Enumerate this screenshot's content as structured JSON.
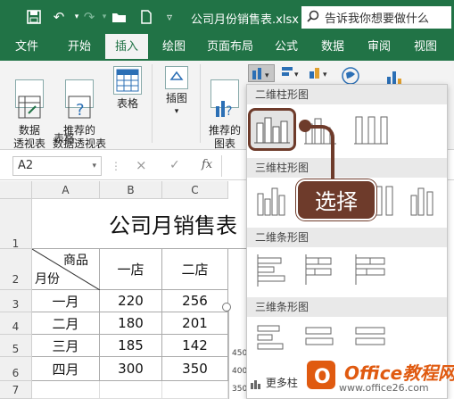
{
  "title_bar": {
    "filename": "公司月份销售表.xlsx  -...",
    "tell_me": "告诉我你想要做什么"
  },
  "tabs": [
    {
      "label": "文件"
    },
    {
      "label": "开始"
    },
    {
      "label": "插入"
    },
    {
      "label": "绘图"
    },
    {
      "label": "页面布局"
    },
    {
      "label": "公式"
    },
    {
      "label": "数据"
    },
    {
      "label": "审阅"
    },
    {
      "label": "视图"
    }
  ],
  "ribbon": {
    "pivot_table": "数据\n透视表",
    "recommended_pivot": "推荐的\n数据透视表",
    "table": "表格",
    "illustrations": "插图",
    "recommended_charts": "推荐的\n图表",
    "group_tables": "表格"
  },
  "formula_bar": {
    "name_box": "A2",
    "cancel": "×",
    "enter": "✓",
    "fx": "fx"
  },
  "sheet": {
    "columns": [
      "A",
      "B",
      "C"
    ],
    "rows": [
      "1",
      "2",
      "3",
      "4",
      "5",
      "6",
      "7"
    ],
    "title": "公司月销售表",
    "header_goods": "商品",
    "header_month": "月份",
    "col_b": "一店",
    "col_c": "二店",
    "months": [
      "一月",
      "二月",
      "三月",
      "四月"
    ],
    "b_values": [
      "220",
      "180",
      "185",
      "300"
    ],
    "c_values": [
      "256",
      "201",
      "142",
      "350"
    ],
    "chart_axis": [
      "450",
      "400",
      "350"
    ]
  },
  "dropdown": {
    "sec_2d_column": "二维柱形图",
    "sec_3d_column": "三维柱形图",
    "sec_2d_bar": "二维条形图",
    "sec_3d_bar": "三维条形图",
    "more": "更多柱"
  },
  "callout": "选择",
  "watermark": {
    "brand": "Office教程网",
    "url": "www.office26.com"
  }
}
